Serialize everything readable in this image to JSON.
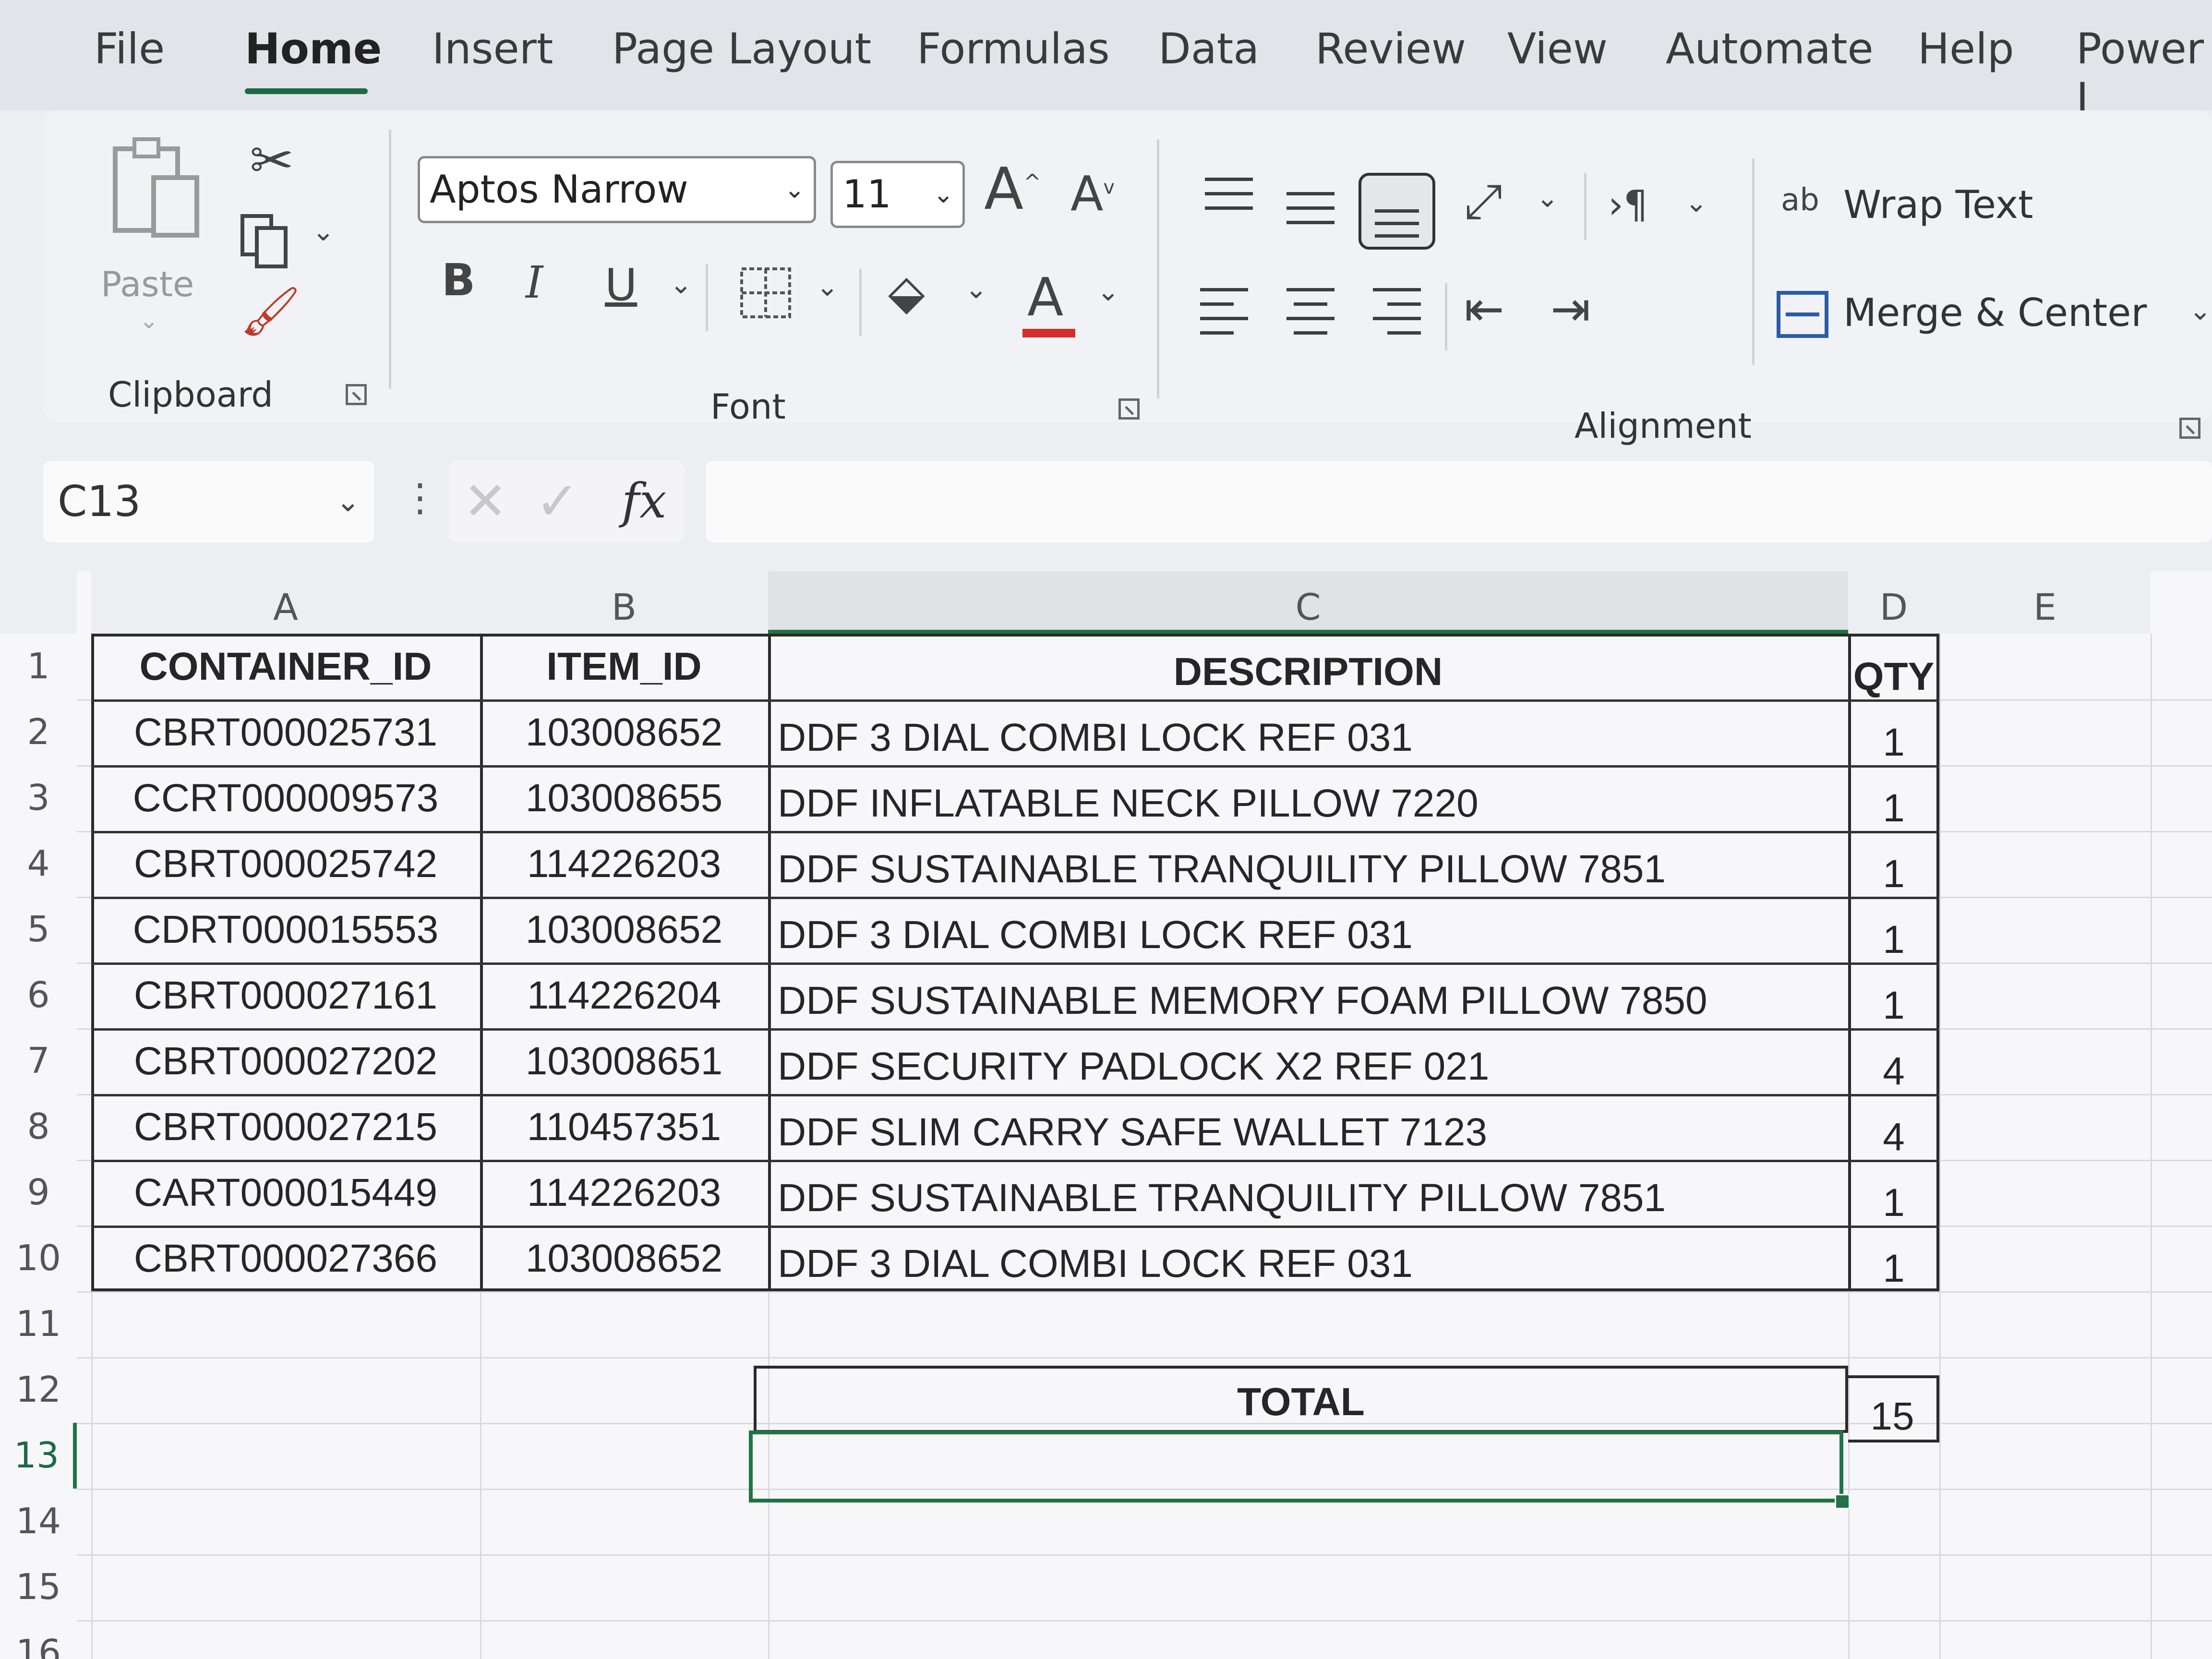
{
  "menu": {
    "tabs": [
      "File",
      "Home",
      "Insert",
      "Page Layout",
      "Formulas",
      "Data",
      "Review",
      "View",
      "Automate",
      "Help",
      "Power I"
    ],
    "active": "Home"
  },
  "ribbon": {
    "clipboard": {
      "paste_label": "Paste",
      "group_label": "Clipboard"
    },
    "font": {
      "font_name": "Aptos Narrow",
      "font_size": "11",
      "bold": "B",
      "italic": "I",
      "underline": "U",
      "increase_glyph": "A",
      "decrease_glyph": "A",
      "font_color_glyph": "A",
      "group_label": "Font",
      "font_color": "#d32f2f"
    },
    "alignment": {
      "wrap_text": "Wrap Text",
      "wrap_icon": "ab",
      "merge_center": "Merge & Center",
      "group_label": "Alignment"
    }
  },
  "formula_bar": {
    "name_box": "C13",
    "fx": "fx",
    "formula": ""
  },
  "grid": {
    "columns": [
      "A",
      "B",
      "C",
      "D",
      "E"
    ],
    "rows": [
      "1",
      "2",
      "3",
      "4",
      "5",
      "6",
      "7",
      "8",
      "9",
      "10",
      "11",
      "12",
      "13",
      "14",
      "15",
      "16"
    ],
    "headers": [
      "CONTAINER_ID",
      "ITEM_ID",
      "DESCRIPTION",
      "QTY"
    ],
    "data": [
      [
        "CBRT000025731",
        "103008652",
        "DDF 3 DIAL COMBI LOCK REF 031",
        "1"
      ],
      [
        "CCRT000009573",
        "103008655",
        "DDF INFLATABLE NECK PILLOW 7220",
        "1"
      ],
      [
        "CBRT000025742",
        "114226203",
        "DDF SUSTAINABLE TRANQUILITY PILLOW 7851",
        "1"
      ],
      [
        "CDRT000015553",
        "103008652",
        "DDF 3 DIAL COMBI LOCK REF 031",
        "1"
      ],
      [
        "CBRT000027161",
        "114226204",
        "DDF SUSTAINABLE MEMORY FOAM PILLOW 7850",
        "1"
      ],
      [
        "CBRT000027202",
        "103008651",
        "DDF SECURITY PADLOCK X2 REF 021",
        "4"
      ],
      [
        "CBRT000027215",
        "110457351",
        "DDF SLIM CARRY SAFE WALLET 7123",
        "4"
      ],
      [
        "CART000015449",
        "114226203",
        "DDF SUSTAINABLE TRANQUILITY PILLOW 7851",
        "1"
      ],
      [
        "CBRT000027366",
        "103008652",
        "DDF 3 DIAL COMBI LOCK REF 031",
        "1"
      ]
    ],
    "total_label": "TOTAL",
    "total_value": "15",
    "selected_cell": "C13",
    "selection_color": "#217346"
  }
}
